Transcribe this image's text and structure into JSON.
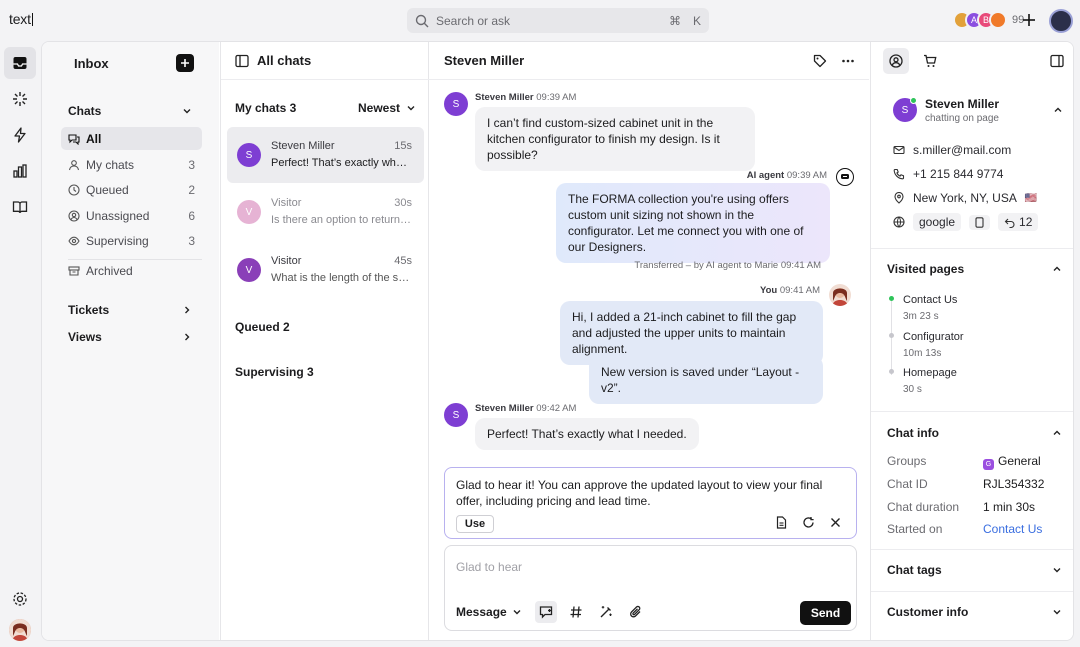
{
  "app": {
    "logo": "text"
  },
  "search": {
    "placeholder": "Search or ask",
    "shortcut_mod": "⌘",
    "shortcut_key": "K"
  },
  "topbar": {
    "team_count": "99"
  },
  "nav": {
    "title": "Inbox",
    "chats_section": "Chats",
    "items": [
      {
        "label": "All",
        "count": ""
      },
      {
        "label": "My chats",
        "count": "3"
      },
      {
        "label": "Queued",
        "count": "2"
      },
      {
        "label": "Unassigned",
        "count": "6"
      },
      {
        "label": "Supervising",
        "count": "3"
      }
    ],
    "archived": "Archived",
    "tickets": "Tickets",
    "views": "Views"
  },
  "list": {
    "title": "All chats",
    "my_chats": "My chats 3",
    "sort": "Newest",
    "queued": "Queued 2",
    "supervising": "Supervising 3",
    "rows": [
      {
        "initial": "S",
        "name": "Steven Miller",
        "time": "15s",
        "message": "Perfect! That’s exactly what I needed.",
        "color": "#7e3ed3"
      },
      {
        "initial": "V",
        "name": "Visitor",
        "time": "30s",
        "message": "Is there an option to return items?",
        "color": "#e6b3d4"
      },
      {
        "initial": "V",
        "name": "Visitor",
        "time": "45s",
        "message": "What is the length of the sofa?",
        "color": "#8a3fb8"
      }
    ]
  },
  "conversation": {
    "title": "Steven Miller",
    "m1": {
      "initial": "S",
      "sender": "Steven Miller",
      "time": "09:39 AM",
      "text": "I can’t find custom-sized cabinet unit in the kitchen configurator to finish my design. Is it possible?"
    },
    "m2": {
      "sender": "AI agent",
      "time": "09:39 AM",
      "text": "The FORMA collection you're using offers custom unit sizing not shown in the configurator. Let me connect you with one of our Designers."
    },
    "transfer": "Transferred – by AI agent to Marie",
    "transfer_time": "09:41 AM",
    "m3": {
      "sender": "You",
      "time": "09:41 AM",
      "text": "Hi, I added a 21-inch cabinet to fill the gap and adjusted the upper units to maintain alignment.",
      "text2": "New version is saved under “Layout - v2”."
    },
    "m4": {
      "initial": "S",
      "sender": "Steven Miller",
      "time": "09:42 AM",
      "text": "Perfect! That’s exactly what I needed."
    },
    "suggestion": {
      "text": "Glad to hear it! You can approve the updated layout to view your final offer, including pricing and lead time.",
      "use": "Use"
    },
    "composer": {
      "placeholder": "Glad to hear",
      "mode": "Message",
      "send": "Send"
    }
  },
  "profile": {
    "initial": "S",
    "name": "Steven Miller",
    "status": "chatting on page",
    "email": "s.miller@mail.com",
    "phone": "+1 215 844 9774",
    "location": "New York, NY, USA",
    "flag": "🇺🇸",
    "source": "google",
    "visits": "12"
  },
  "visited": {
    "title": "Visited pages",
    "pages": [
      {
        "page": "Contact Us",
        "duration": "3m 23 s"
      },
      {
        "page": "Configurator",
        "duration": "10m 13s"
      },
      {
        "page": "Homepage",
        "duration": "30 s"
      }
    ]
  },
  "chat_info": {
    "title": "Chat info",
    "rows": [
      {
        "key": "Groups",
        "value": "General"
      },
      {
        "key": "Chat ID",
        "value": "RJL354332"
      },
      {
        "key": "Chat duration",
        "value": "1 min 30s"
      },
      {
        "key": "Started on",
        "value": "Contact Us"
      }
    ]
  },
  "chat_tags": {
    "title": "Chat tags"
  },
  "customer_info": {
    "title": "Customer info"
  },
  "colors": {
    "accent": "#7e3ed3",
    "online": "#2ec45a",
    "link": "#3a6ee0"
  }
}
